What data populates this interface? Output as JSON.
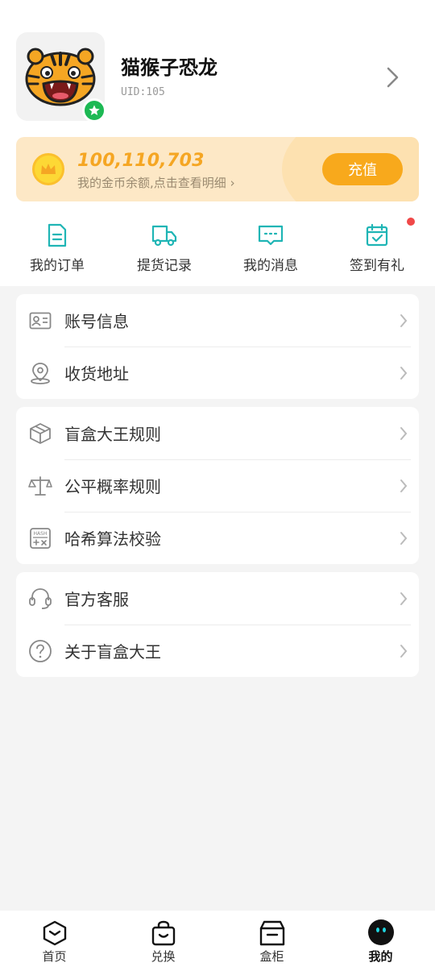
{
  "profile": {
    "nickname": "猫猴子恐龙",
    "uid": "UID:105"
  },
  "wallet": {
    "balance": "100,110,703",
    "hint": "我的金币余额,点击查看明细",
    "hint_arrow": "›",
    "recharge_label": "充值"
  },
  "quick_actions": [
    {
      "label": "我的订单",
      "icon": "document-icon"
    },
    {
      "label": "提货记录",
      "icon": "truck-icon"
    },
    {
      "label": "我的消息",
      "icon": "message-icon"
    },
    {
      "label": "签到有礼",
      "icon": "calendar-check-icon",
      "has_badge": true
    }
  ],
  "menu_groups": [
    {
      "items": [
        {
          "label": "账号信息",
          "icon": "id-card-icon"
        },
        {
          "label": "收货地址",
          "icon": "location-pin-icon"
        }
      ]
    },
    {
      "items": [
        {
          "label": "盲盒大王规则",
          "icon": "box-icon"
        },
        {
          "label": "公平概率规则",
          "icon": "scale-icon"
        },
        {
          "label": "哈希算法校验",
          "icon": "hash-calculator-icon"
        }
      ]
    },
    {
      "items": [
        {
          "label": "官方客服",
          "icon": "headset-icon"
        },
        {
          "label": "关于盲盒大王",
          "icon": "question-icon"
        }
      ]
    }
  ],
  "tabbar": [
    {
      "label": "首页",
      "icon": "home-box-icon"
    },
    {
      "label": "兑换",
      "icon": "shopping-bag-icon"
    },
    {
      "label": "盒柜",
      "icon": "cabinet-icon"
    },
    {
      "label": "我的",
      "icon": "profile-face-icon",
      "active": true
    }
  ],
  "colors": {
    "teal_icon": "#1fb5b5",
    "accent_orange": "#f8a91c",
    "badge_red": "#f04848",
    "verified_green": "#1db954"
  }
}
